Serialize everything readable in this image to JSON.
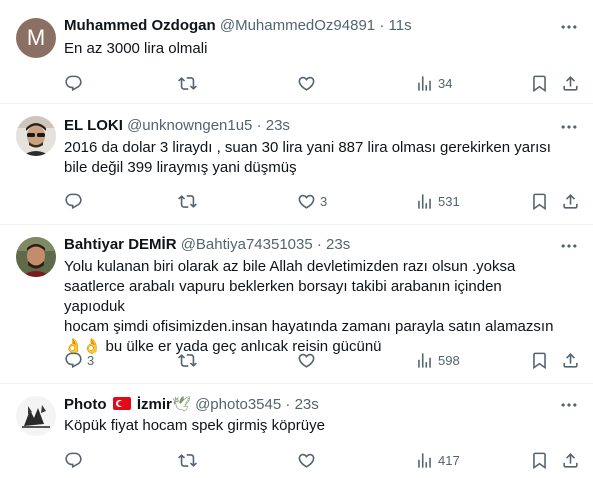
{
  "tweets": [
    {
      "name": "Muhammed Ozdogan",
      "handle": "@MuhammedOz94891",
      "time": "11s",
      "avatar_letter": "M",
      "text": "En az 3000 lira olmali",
      "replies": "",
      "retweets": "",
      "likes": "",
      "views": "34"
    },
    {
      "name": "EL LOKI",
      "handle": "@unknowngen1u5",
      "time": "23s",
      "text": "2016 da dolar 3 liraydı , suan 30 lira yani 887 lira olması gerekirken yarısı\nbile değil 399 liraymış yani düşmüş",
      "replies": "",
      "retweets": "",
      "likes": "3",
      "views": "531"
    },
    {
      "name": "Bahtiyar DEMİR",
      "handle": "@Bahtiya74351035",
      "time": "23s",
      "text": "Yolu kulanan biri olarak az bile Allah devletimizden razı olsun .yoksa\nsaatlerce arabalı vapuru beklerken borsayı takibi arabanın içinden yapıoduk\nhocam şimdi ofisimizden.insan hayatında zamanı parayla satın alamazsın\n👌👌 bu ülke er yada geç anlıcak reisin gücünü",
      "replies": "3",
      "retweets": "",
      "likes": "",
      "views": "598"
    },
    {
      "name": "Photo",
      "name_suffix": "İzmir",
      "handle": "@photo3545",
      "time": "23s",
      "text": "Köpük fiyat hocam spek girmiş köprüye",
      "replies": "",
      "retweets": "",
      "likes": "",
      "views": "417"
    }
  ],
  "separator": "·",
  "colors": {
    "text": "#0f1419",
    "muted": "#536471",
    "border": "#eff3f4"
  },
  "icons": [
    "reply-icon",
    "retweet-icon",
    "like-icon",
    "views-icon",
    "bookmark-icon",
    "share-icon",
    "more-icon"
  ]
}
